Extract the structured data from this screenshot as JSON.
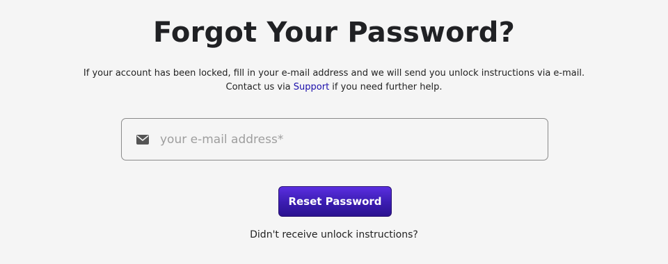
{
  "header": {
    "title": "Forgot Your Password?"
  },
  "description": {
    "line1": "If your account has been locked, fill in your e-mail address and we will send you unlock instructions via e-mail.",
    "line2_prefix": "Contact us via ",
    "support_link": "Support",
    "line2_suffix": " if you need further help."
  },
  "form": {
    "email_placeholder": "your e-mail address*",
    "email_value": "",
    "email_icon": "envelope-icon",
    "reset_button_label": "Reset Password"
  },
  "footer": {
    "unlock_instructions_link": "Didn't receive unlock instructions?"
  },
  "colors": {
    "background": "#f5f5f5",
    "link": "#1a0dab",
    "button": "#3a1cb0"
  }
}
